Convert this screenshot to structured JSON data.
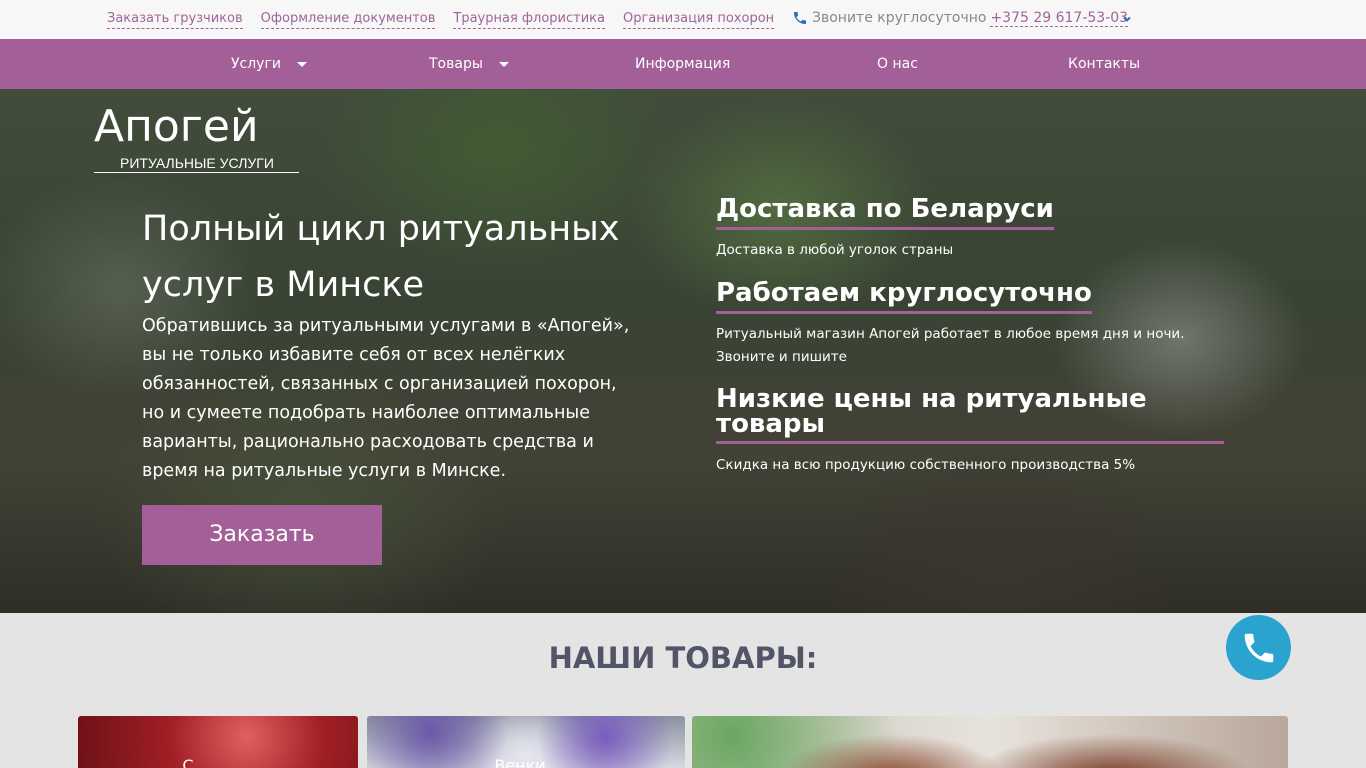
{
  "topbar": {
    "links": [
      "Заказать грузчиков",
      "Оформление документов",
      "Траурная флористика",
      "Организация похорон"
    ],
    "phone_label": "Звоните круглосуточно",
    "phone_number": "+375 29 617-53-03"
  },
  "nav": {
    "items": [
      {
        "label": "Услуги",
        "has_dropdown": true
      },
      {
        "label": "Товары",
        "has_dropdown": true
      },
      {
        "label": "Информация",
        "has_dropdown": false
      },
      {
        "label": "О нас",
        "has_dropdown": false
      },
      {
        "label": "Контакты",
        "has_dropdown": false
      }
    ]
  },
  "logo": {
    "word": "Апогей",
    "subtitle": "РИТУАЛЬНЫЕ УСЛУГИ"
  },
  "hero": {
    "title": "Полный цикл ритуальных услуг в Минске",
    "text": "Обратившись за ритуальными услугами в «Апогей», вы не только избавите себя от всех нелёгких обязанностей, связанных с организацией похорон, но и сумеете подобрать наиболее оптимальные варианты, рационально расходовать средства и время на ритуальные услуги в Минске.",
    "button_label": "Заказать"
  },
  "features": [
    {
      "title": "Доставка по Беларуси",
      "text": "Доставка в любой уголок страны"
    },
    {
      "title": "Работаем круглосуточно",
      "text": "Ритуальный магазин Апогей работает в любое время дня и ночи. Звоните и пишите"
    },
    {
      "title": "Низкие цены на ритуальные товары",
      "text": "Скидка на всю продукцию собственного производства 5%"
    }
  ],
  "products": {
    "title": "НАШИ ТОВАРЫ:",
    "cards": [
      {
        "label": "С"
      },
      {
        "label": "Венки"
      },
      {
        "label": ""
      }
    ]
  },
  "colors": {
    "accent": "#a35f98",
    "call_button": "#2aa3cf",
    "section_title": "#525468"
  },
  "icons": {
    "phone": "phone-icon",
    "chevron": "chevron-down-icon",
    "call": "phone-call-icon"
  }
}
